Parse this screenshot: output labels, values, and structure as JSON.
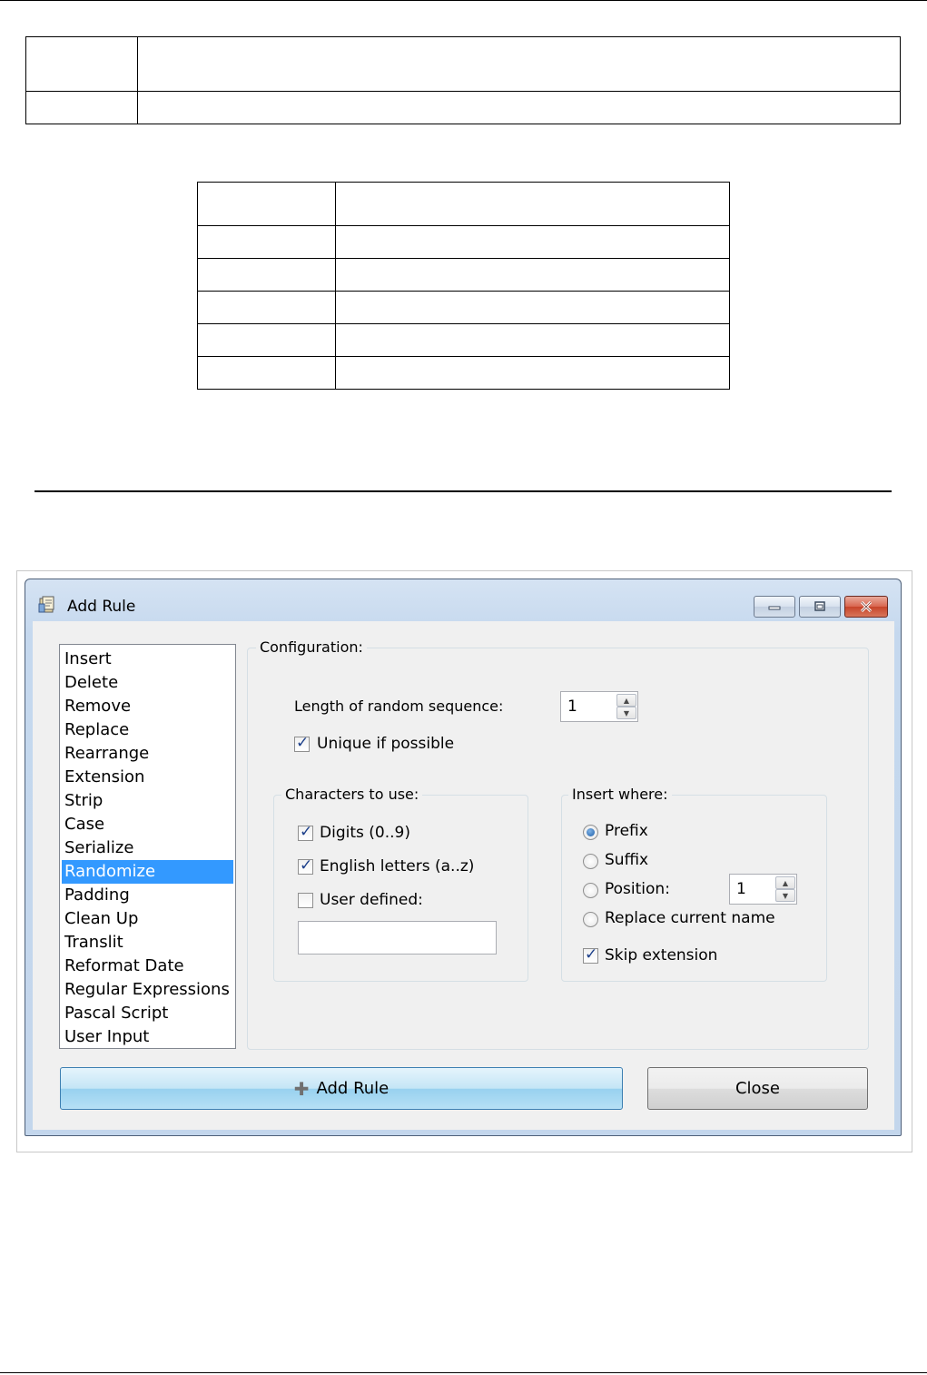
{
  "window": {
    "title": "Add Rule",
    "minimize_glyph": "▭",
    "maximize_glyph": "▣",
    "close_glyph": "✕"
  },
  "rules": {
    "items": [
      "Insert",
      "Delete",
      "Remove",
      "Replace",
      "Rearrange",
      "Extension",
      "Strip",
      "Case",
      "Serialize",
      "Randomize",
      "Padding",
      "Clean Up",
      "Translit",
      "Reformat Date",
      "Regular Expressions",
      "Pascal Script",
      "User Input"
    ],
    "selected": "Randomize"
  },
  "config": {
    "group_label": "Configuration:",
    "length_label": "Length of random sequence:",
    "length_value": "1",
    "unique_label": "Unique if possible",
    "unique_checked": true,
    "chars_group_label": "Characters to use:",
    "digits_label": "Digits (0..9)",
    "digits_checked": true,
    "letters_label": "English letters (a..z)",
    "letters_checked": true,
    "user_defined_label": "User defined:",
    "user_defined_checked": false,
    "user_defined_value": "",
    "insert_group_label": "Insert where:",
    "prefix_label": "Prefix",
    "suffix_label": "Suffix",
    "position_label": "Position:",
    "position_value": "1",
    "replace_label": "Replace current name",
    "selected_insert": "Prefix",
    "skip_ext_label": "Skip extension",
    "skip_ext_checked": true
  },
  "buttons": {
    "add_rule": "Add Rule",
    "close": "Close"
  },
  "colors": {
    "selection": "#3399ff",
    "dialog_bg": "#f0f0f0",
    "frame": "#c5d8ee"
  }
}
